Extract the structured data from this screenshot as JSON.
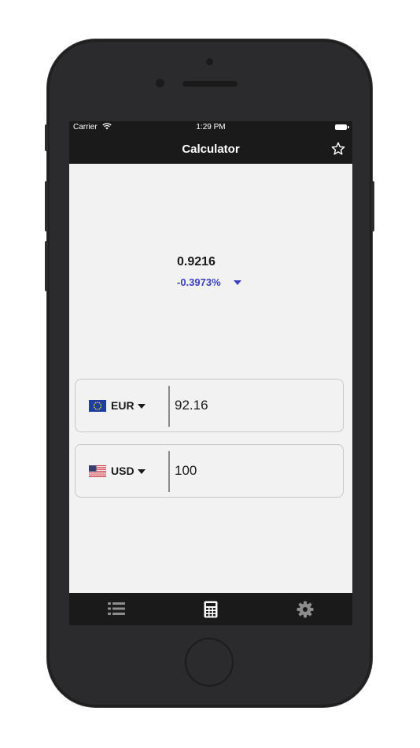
{
  "status_bar": {
    "carrier": "Carrier",
    "time": "1:29 PM"
  },
  "nav": {
    "title": "Calculator",
    "favorite_icon": "star-outline-icon"
  },
  "rate": {
    "value": "0.9216",
    "change": "-0.3973%",
    "direction": "down",
    "change_color": "#3b3fc4"
  },
  "converter": {
    "rows": [
      {
        "currency": "EUR",
        "flag": "eu-flag",
        "amount": "92.16"
      },
      {
        "currency": "USD",
        "flag": "us-flag",
        "amount": "100"
      }
    ]
  },
  "tab_bar": {
    "tabs": [
      {
        "icon": "list-icon",
        "active": false
      },
      {
        "icon": "calculator-icon",
        "active": true
      },
      {
        "icon": "gear-icon",
        "active": false
      }
    ]
  },
  "colors": {
    "bar_background": "#1a1a1a",
    "screen_background": "#f2f2f2",
    "accent": "#3b3fc4"
  }
}
